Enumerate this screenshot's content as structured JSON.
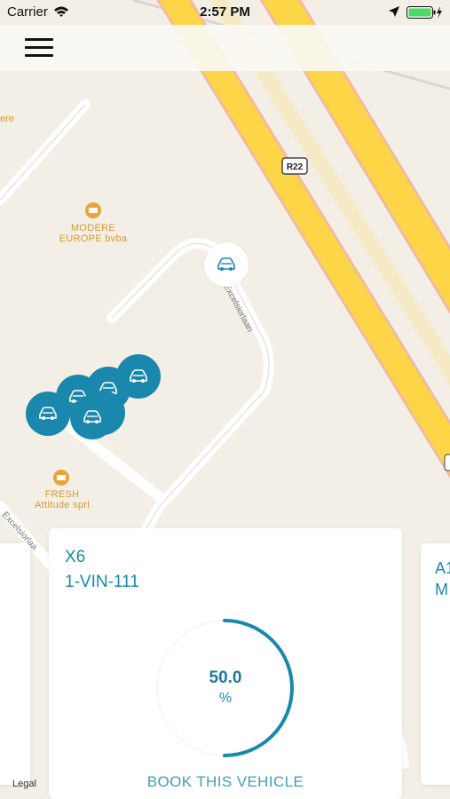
{
  "status_bar": {
    "carrier": "Carrier",
    "time": "2:57 PM"
  },
  "map": {
    "pois": [
      {
        "line1": "MODERE",
        "line2": "EUROPE bvba"
      },
      {
        "line1": "FRESH",
        "line2": "Attitude sprl"
      }
    ],
    "road_shield": "R22",
    "street_label": "Excelsiorlaan",
    "street_label_2": "Excelsiorlaa",
    "edge_label": "ere",
    "legal": "Legal"
  },
  "vehicle_card": {
    "model": "X6",
    "plate": "1-VIN-111",
    "fuel_value": "50.0",
    "fuel_unit": "%",
    "fuel_level": 0.5,
    "book_label": "BOOK THIS VEHICLE"
  },
  "next_card": {
    "line1": "A1",
    "line2": "M"
  },
  "colors": {
    "accent": "#1a88ad",
    "highway": "#fcd647"
  }
}
